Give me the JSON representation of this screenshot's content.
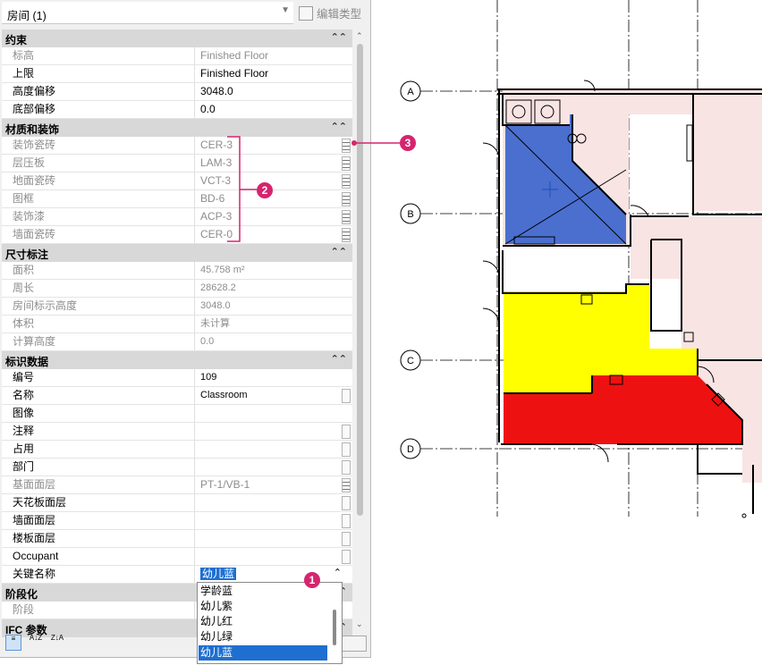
{
  "type_selector": {
    "label": "房间 (1)",
    "edit_type_label": "编辑类型"
  },
  "groups": {
    "constraints": "约束",
    "materials": "材质和装饰",
    "dimensions": "尺寸标注",
    "identity": "标识数据",
    "phasing": "阶段化",
    "ifc": "IFC 参数"
  },
  "constraints": [
    {
      "label": "标高",
      "value": "Finished Floor"
    },
    {
      "label": "上限",
      "value": "Finished Floor"
    },
    {
      "label": "高度偏移",
      "value": "3048.0"
    },
    {
      "label": "底部偏移",
      "value": "0.0"
    }
  ],
  "materials": [
    {
      "label": "装饰瓷砖",
      "value": "CER-3"
    },
    {
      "label": "层压板",
      "value": "LAM-3"
    },
    {
      "label": "地面瓷砖",
      "value": "VCT-3"
    },
    {
      "label": "图框",
      "value": "BD-6"
    },
    {
      "label": "装饰漆",
      "value": "ACP-3"
    },
    {
      "label": "墙面瓷砖",
      "value": "CER-0"
    }
  ],
  "dimensions": [
    {
      "label": "面积",
      "value": "45.758 m²"
    },
    {
      "label": "周长",
      "value": "28628.2"
    },
    {
      "label": "房间标示高度",
      "value": "3048.0"
    },
    {
      "label": "体积",
      "value": "未计算"
    },
    {
      "label": "计算高度",
      "value": "0.0"
    }
  ],
  "identity": [
    {
      "label": "编号",
      "value": "109"
    },
    {
      "label": "名称",
      "value": "Classroom"
    },
    {
      "label": "图像",
      "value": ""
    },
    {
      "label": "注释",
      "value": ""
    },
    {
      "label": "占用",
      "value": ""
    },
    {
      "label": "部门",
      "value": ""
    },
    {
      "label": "基面面层",
      "value": "PT-1/VB-1"
    },
    {
      "label": "天花板面层",
      "value": ""
    },
    {
      "label": "墙面面层",
      "value": ""
    },
    {
      "label": "楼板面层",
      "value": ""
    },
    {
      "label": "Occupant",
      "value": ""
    },
    {
      "label": "关键名称",
      "value": "幼儿蓝"
    }
  ],
  "phasing": [
    {
      "label": "阶段",
      "value": ""
    }
  ],
  "dropdown": {
    "options": [
      "学龄蓝",
      "幼儿紫",
      "幼儿红",
      "幼儿绿",
      "幼儿蓝"
    ],
    "selected": "幼儿蓝"
  },
  "callouts": {
    "one": "1",
    "two": "2",
    "three": "3"
  },
  "grid_labels": [
    "A",
    "B",
    "C",
    "D"
  ],
  "colors": {
    "accent": "#d6246e",
    "room_blue": "#4a6fcf",
    "room_yellow": "#ffff00",
    "room_red": "#ee1111",
    "room_pink": "#f9e4e4",
    "selection": "#1f6fd1"
  },
  "icons": {
    "lock": "lock-icon",
    "collapse": "collapse-chevron-icon",
    "edit_type": "edit-type-icon",
    "sort_category": "sort-category-icon",
    "sort_az": "sort-az-icon",
    "sort_za": "sort-za-icon"
  }
}
